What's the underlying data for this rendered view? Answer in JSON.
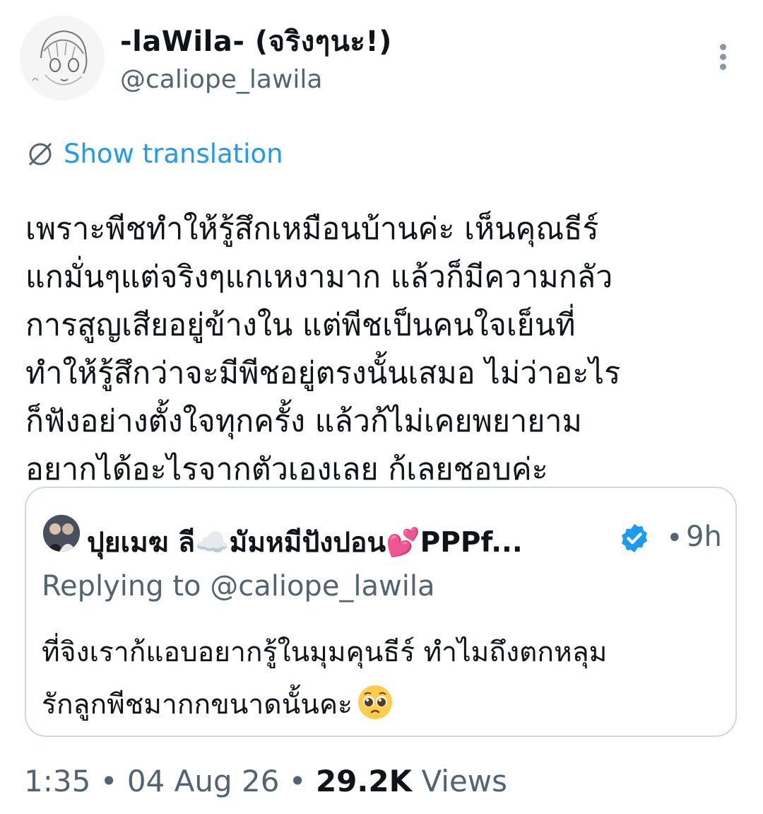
{
  "author": {
    "display_name": "-laWila- (จริงๆนะ!)",
    "handle": "@caliope_lawila",
    "avatar_icon": "anime-sketch-avatar"
  },
  "more_icon": "more-vertical-icon",
  "translation": {
    "label": "Show translation",
    "icon": "translate-globe-icon"
  },
  "tweet": {
    "lines": [
      "เพราะพีชทำให้รู้สึกเหมือนบ้านค่ะ เห็นคุณธีร์",
      "แกมั่นๆแต่จริงๆแกเหงามาก แล้วก็มีความกลัว",
      "การสูญเสียอยู่ข้างใน แต่พีชเป็นคนใจเย็นที่",
      "ทำให้รู้สึกว่าจะมีพีชอยู่ตรงนั้นเสมอ ไม่ว่าอะไร",
      "ก็ฟังอย่างตั้งใจทุกครั้ง แล้วก้ไม่เคยพยายาม",
      "อยากได้อะไรจากตัวเองเลย ก้เลยชอบค่ะ"
    ]
  },
  "quoted": {
    "name": "ปุยเมฆ ลี☁️มัมหมีปังปอน💕PPPf...",
    "verified_icon": "verified-badge-icon",
    "separator": "•",
    "time": "9h",
    "replying_to": "Replying to @caliope_lawila",
    "lines": [
      "ที่จิงเราก้แอบอยากรู้ในมุมคุนธีร์ ทำไมถึงตกหลุม",
      "รักลูกพีชมากกขนาดนั้นคะ"
    ],
    "emoji": "pleading-face-emoji"
  },
  "meta": {
    "time": "1:35",
    "sep1": "•",
    "date": "04 Aug 26",
    "sep2": "•",
    "views_count": "29.2K",
    "views_label": "Views"
  },
  "colors": {
    "link_blue": "#1d9bf0",
    "text": "#0f1419",
    "secondary": "#536471",
    "border": "#cfd9de"
  }
}
